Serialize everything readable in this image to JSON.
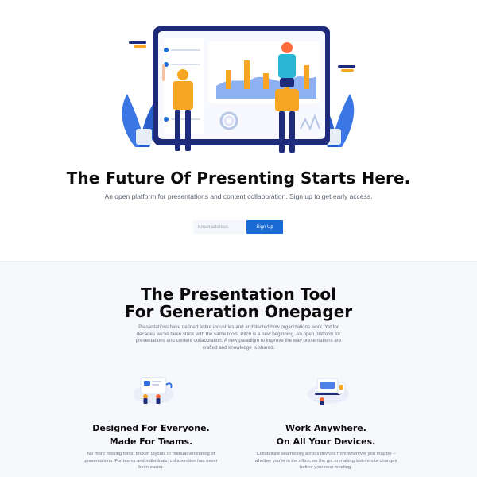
{
  "hero": {
    "title": "The Future Of Presenting Starts Here.",
    "subtitle": "An open platform for presentations and content collaboration. Sign up to get early access.",
    "email_placeholder": "Email address",
    "signup_label": "Sign Up"
  },
  "section2": {
    "title_line1": "The Presentation Tool",
    "title_line2": "For Generation Onepager",
    "body": "Presentations have defined entire industries and architected how organizations work. Yet for decades we’ve been stuck with the same tools. Pitch is a new beginning. An open platform for presentations and content collaboration. A new paradigm to improve the way presentations are crafted and knowledge is shared.",
    "features": [
      {
        "title_line1": "Designed For Everyone.",
        "title_line2": "Made For Teams.",
        "body": "No more missing fonts, broken layouts or manual versioning of presentations. For teams and individuals, collaboration has never been easier."
      },
      {
        "title_line1": "Work Anywhere.",
        "title_line2": "On All Your Devices.",
        "body": "Collaborate seamlessly across devices from wherever you may be – whether you’re in the office, on the go, or making last-minute changes before your next meeting."
      }
    ]
  },
  "colors": {
    "brand_blue": "#1a6ad6",
    "accent_orange": "#f6a623",
    "dark_navy": "#1d2b7a",
    "section_bg": "#f6f8fb"
  },
  "icons": {
    "hero": "presentation-board-illustration",
    "feature_left": "team-collaboration-illustration",
    "feature_right": "devices-illustration"
  }
}
